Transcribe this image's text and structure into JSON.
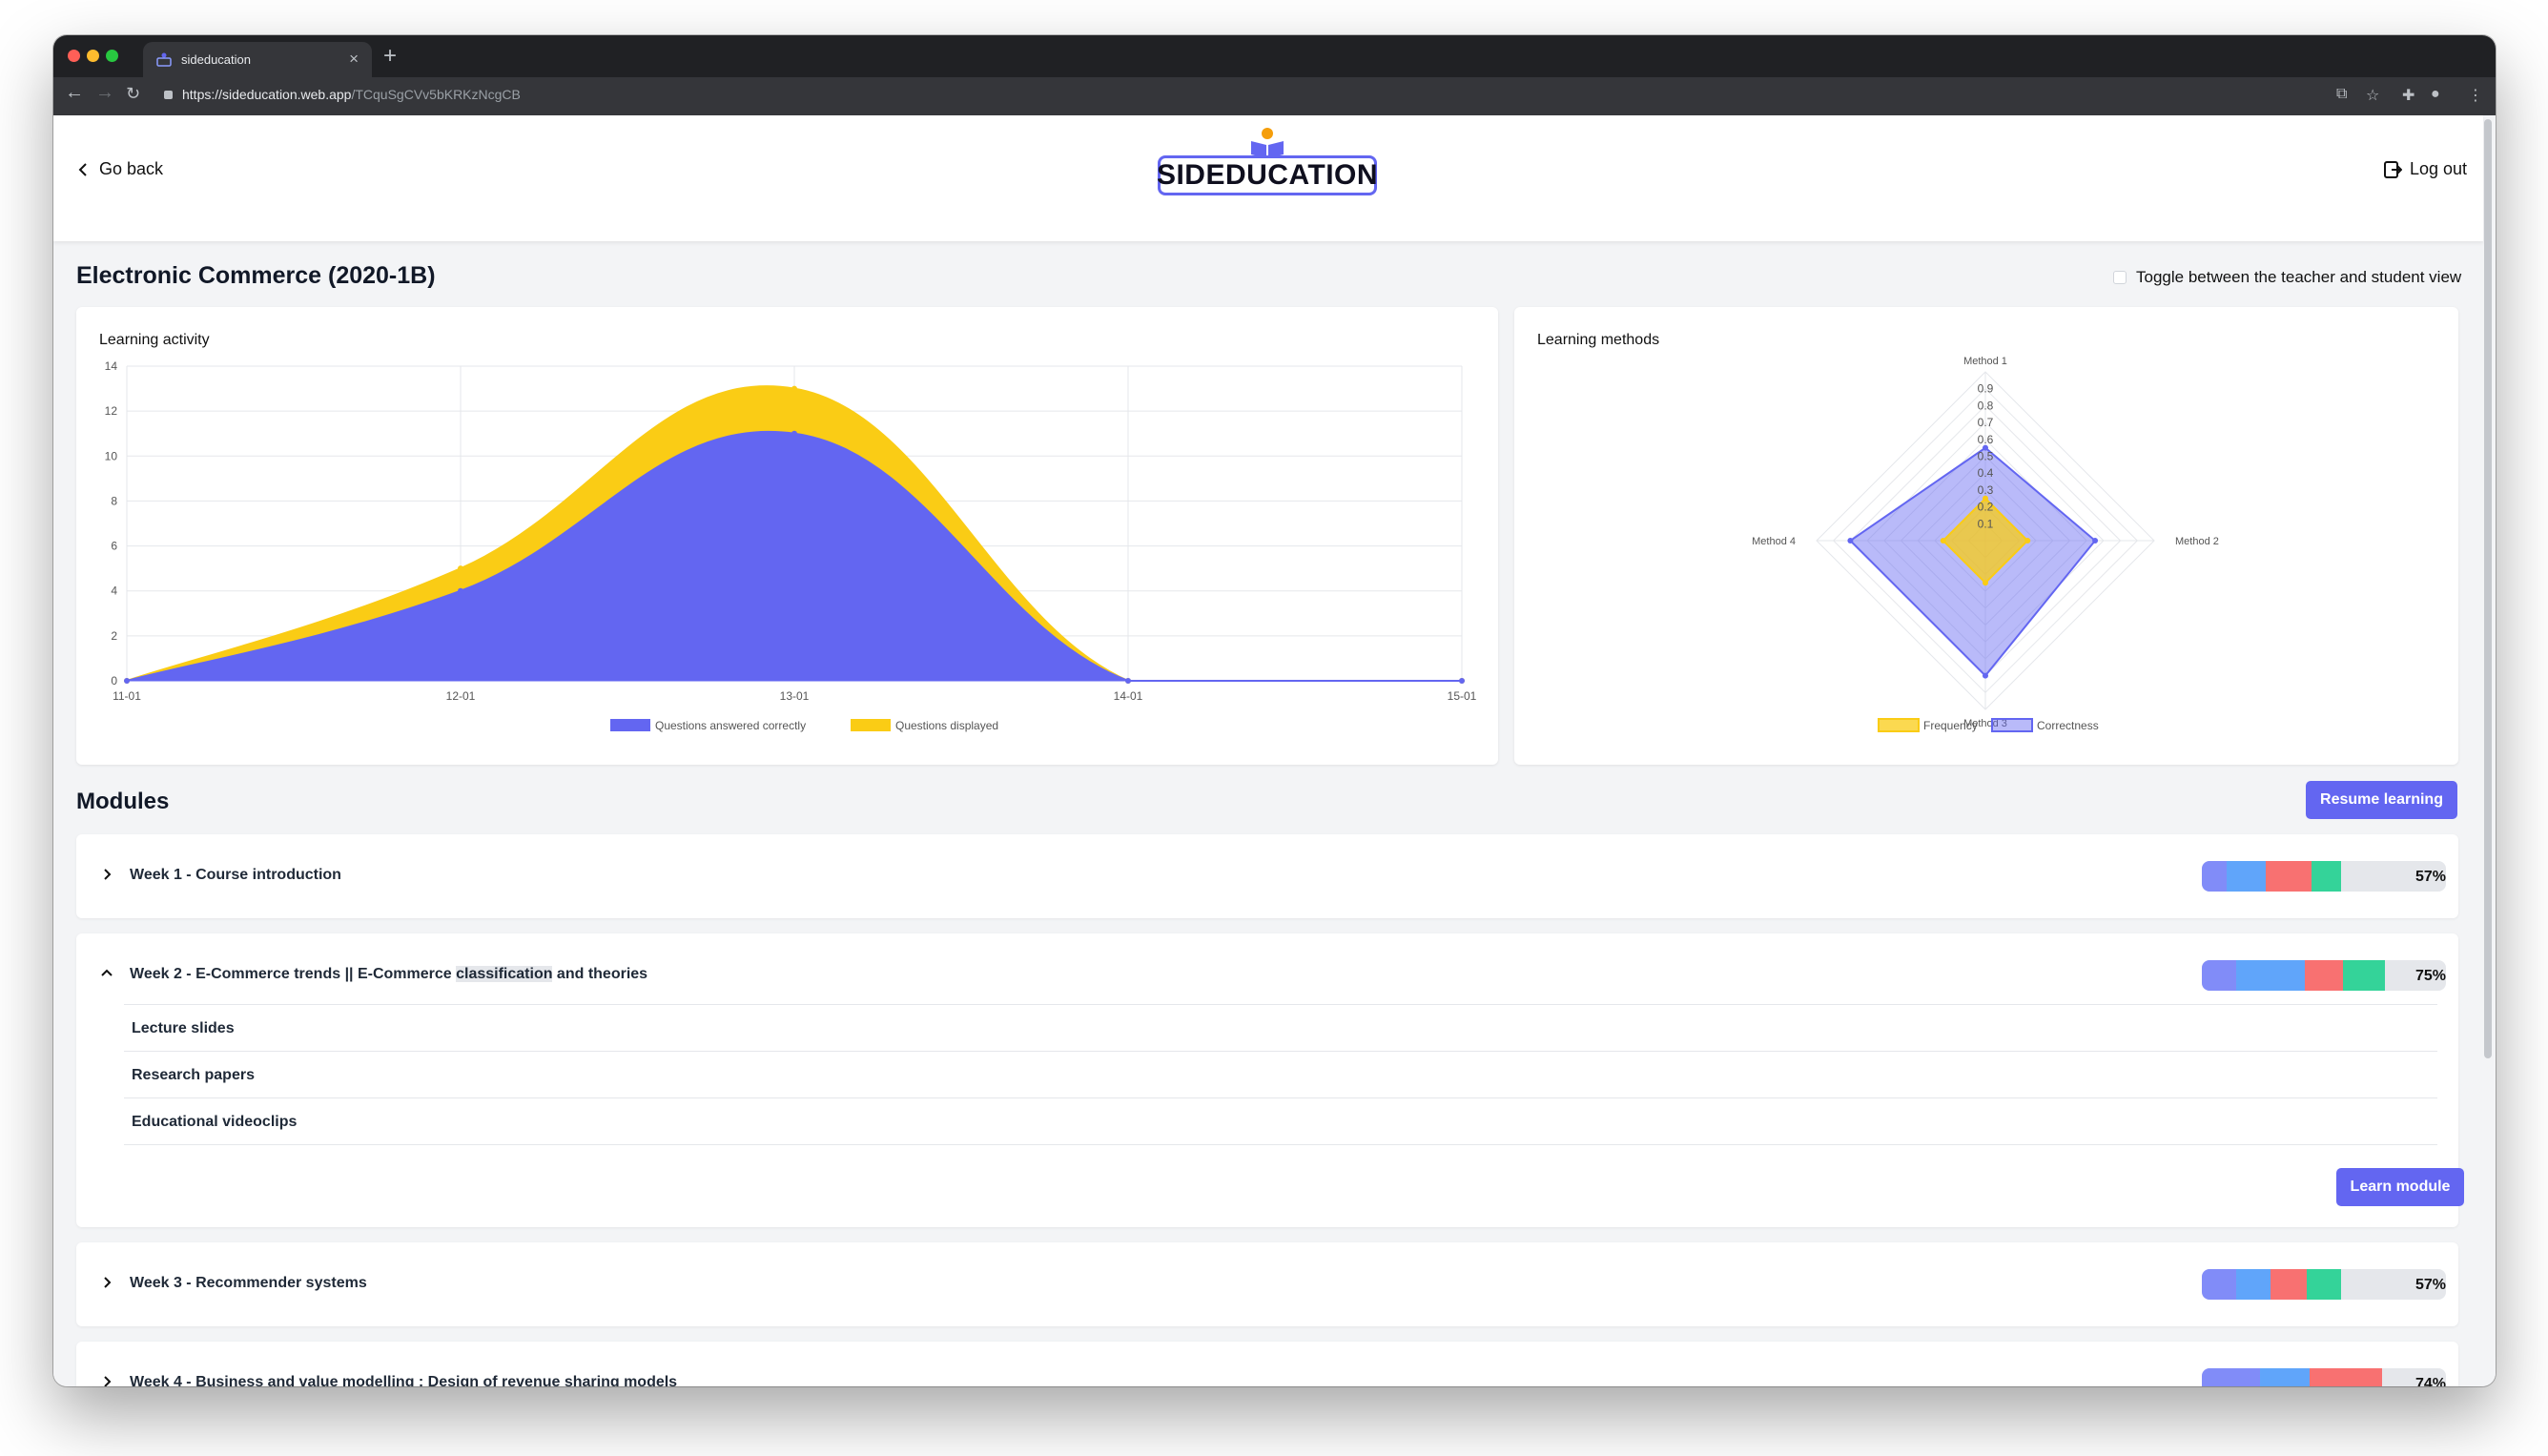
{
  "browser": {
    "tab_title": "sideducation",
    "url_host": "https://sideducation.web.app",
    "url_path": "/TCquSgCVv5bKRKzNcgCB"
  },
  "header": {
    "back_label": "Go back",
    "logo_text": "SIDEDUCATION",
    "logout_label": "Log out"
  },
  "course": {
    "title": "Electronic Commerce (2020-1B)",
    "toggle_label": "Toggle between the teacher and student view"
  },
  "colors": {
    "accent": "#6366f1",
    "yellow": "#facc15",
    "progress_segments": [
      "#818cf8",
      "#60a5fa",
      "#f87171",
      "#34d399"
    ],
    "progress_track": "#e5e7eb"
  },
  "learning_activity": {
    "title": "Learning activity",
    "chart_data": {
      "type": "area",
      "x": [
        "11-01",
        "12-01",
        "13-01",
        "14-01",
        "15-01"
      ],
      "ylim": [
        0,
        14
      ],
      "yticks": [
        0,
        2,
        4,
        6,
        8,
        10,
        12,
        14
      ],
      "grid": true,
      "legend": "bottom",
      "series": [
        {
          "name": "Questions answered correctly",
          "values": [
            0,
            4,
            11,
            0,
            0
          ],
          "color": "#6366f1"
        },
        {
          "name": "Questions displayed",
          "values": [
            0,
            5,
            13,
            0,
            0
          ],
          "color": "#facc15"
        }
      ]
    }
  },
  "learning_methods": {
    "title": "Learning methods",
    "chart_data": {
      "type": "radar",
      "axes": [
        "Method 1",
        "Method 2",
        "Method 3",
        "Method 4"
      ],
      "ticks": [
        "0.1",
        "0.2",
        "0.3",
        "0.4",
        "0.5",
        "0.6",
        "0.7",
        "0.8",
        "0.9"
      ],
      "rmax": 1.0,
      "legend": "bottom",
      "series": [
        {
          "name": "Frequency",
          "values": [
            0.25,
            0.25,
            0.25,
            0.25
          ],
          "color": "#facc15"
        },
        {
          "name": "Correctness",
          "values": [
            0.55,
            0.65,
            0.8,
            0.8
          ],
          "color": "#6366f1"
        }
      ]
    }
  },
  "modules": {
    "title": "Modules",
    "resume_label": "Resume learning",
    "learn_label": "Learn module",
    "items": [
      {
        "label": "Week 1 - Course introduction",
        "percent": "57%",
        "segments": [
          0.1,
          0.16,
          0.19,
          0.12
        ]
      },
      {
        "label_pre": "Week 2 - E-Commerce trends || E-Commerce ",
        "label_hl": "classification",
        "label_post": " and theories",
        "percent": "75%",
        "segments": [
          0.14,
          0.28,
          0.16,
          0.17
        ]
      },
      {
        "label": "Week 3 - Recommender systems",
        "percent": "57%",
        "segments": [
          0.14,
          0.14,
          0.15,
          0.14
        ]
      },
      {
        "label": "Week 4 - Business and value modelling : Design of revenue sharing models",
        "percent": "74%",
        "segments": [
          0.24,
          0.2,
          0.3,
          0
        ]
      }
    ],
    "open_sub_items": [
      "Lecture slides",
      "Research papers",
      "Educational videoclips"
    ]
  }
}
